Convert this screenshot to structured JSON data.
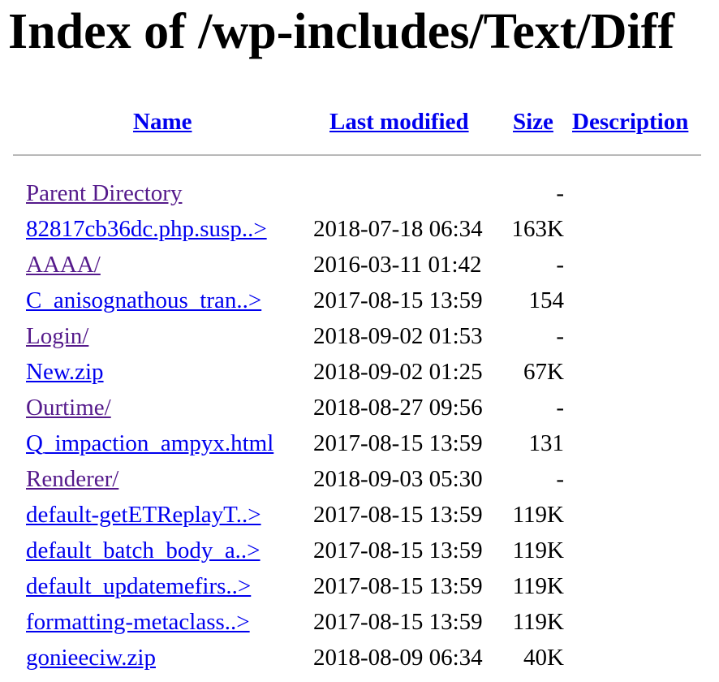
{
  "page": {
    "title": "Index of /wp-includes/Text/Diff"
  },
  "table": {
    "headers": {
      "name": "Name",
      "last_modified": "Last modified",
      "size": "Size",
      "description": "Description"
    },
    "rows": [
      {
        "name": "Parent Directory",
        "date": "",
        "size": "-",
        "visited": true
      },
      {
        "name": "82817cb36dc.php.susp..>",
        "date": "2018-07-18 06:34",
        "size": "163K",
        "visited": false
      },
      {
        "name": "AAAA/",
        "date": "2016-03-11 01:42",
        "size": "-",
        "visited": true
      },
      {
        "name": "C_anisognathous_tran..>",
        "date": "2017-08-15 13:59",
        "size": "154",
        "visited": false
      },
      {
        "name": "Login/",
        "date": "2018-09-02 01:53",
        "size": "-",
        "visited": true
      },
      {
        "name": "New.zip",
        "date": "2018-09-02 01:25",
        "size": "67K",
        "visited": false
      },
      {
        "name": "Ourtime/",
        "date": "2018-08-27 09:56",
        "size": "-",
        "visited": true
      },
      {
        "name": "Q_impaction_ampyx.html",
        "date": "2017-08-15 13:59",
        "size": "131",
        "visited": false
      },
      {
        "name": "Renderer/",
        "date": "2018-09-03 05:30",
        "size": "-",
        "visited": true
      },
      {
        "name": "default-getETReplayT..>",
        "date": "2017-08-15 13:59",
        "size": "119K",
        "visited": false
      },
      {
        "name": "default_batch_body_a..>",
        "date": "2017-08-15 13:59",
        "size": "119K",
        "visited": false
      },
      {
        "name": "default_updatemefirs..>",
        "date": "2017-08-15 13:59",
        "size": "119K",
        "visited": false
      },
      {
        "name": "formatting-metaclass..>",
        "date": "2017-08-15 13:59",
        "size": "119K",
        "visited": false
      },
      {
        "name": "gonieeciw.zip",
        "date": "2018-08-09 06:34",
        "size": "40K",
        "visited": false
      }
    ]
  },
  "colors": {
    "link": "#0000ee",
    "visited_link": "#551a8b",
    "rule": "#b8b8b8"
  }
}
